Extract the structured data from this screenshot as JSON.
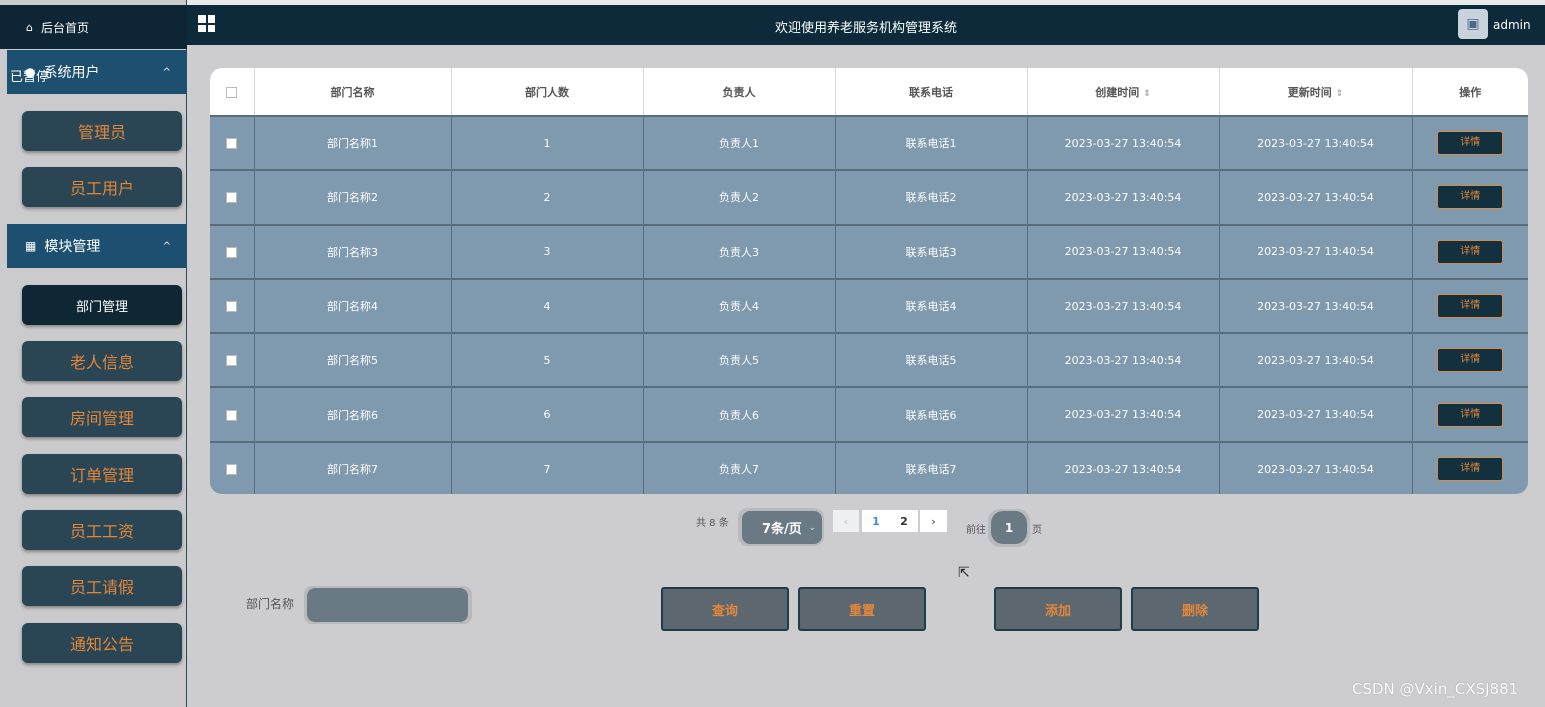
{
  "sidebar": {
    "home_label": "后台首页",
    "paused_label": "已暂停",
    "groups": [
      {
        "label": "系统用户",
        "items": [
          "管理员",
          "员工用户"
        ]
      },
      {
        "label": "模块管理",
        "items": [
          "部门管理",
          "老人信息",
          "房间管理",
          "订单管理",
          "员工工资",
          "员工请假",
          "通知公告"
        ]
      }
    ]
  },
  "topbar": {
    "title": "欢迎使用养老服务机构管理系统",
    "user": "admin"
  },
  "table": {
    "headers": [
      "部门名称",
      "部门人数",
      "负责人",
      "联系电话",
      "创建时间",
      "更新时间",
      "操作"
    ],
    "sort_glyph": "⇕",
    "detail_label": "详情",
    "rows": [
      [
        "部门名称1",
        "1",
        "负责人1",
        "联系电话1",
        "2023-03-27 13:40:54",
        "2023-03-27 13:40:54"
      ],
      [
        "部门名称2",
        "2",
        "负责人2",
        "联系电话2",
        "2023-03-27 13:40:54",
        "2023-03-27 13:40:54"
      ],
      [
        "部门名称3",
        "3",
        "负责人3",
        "联系电话3",
        "2023-03-27 13:40:54",
        "2023-03-27 13:40:54"
      ],
      [
        "部门名称4",
        "4",
        "负责人4",
        "联系电话4",
        "2023-03-27 13:40:54",
        "2023-03-27 13:40:54"
      ],
      [
        "部门名称5",
        "5",
        "负责人5",
        "联系电话5",
        "2023-03-27 13:40:54",
        "2023-03-27 13:40:54"
      ],
      [
        "部门名称6",
        "6",
        "负责人6",
        "联系电话6",
        "2023-03-27 13:40:54",
        "2023-03-27 13:40:54"
      ],
      [
        "部门名称7",
        "7",
        "负责人7",
        "联系电话7",
        "2023-03-27 13:40:54",
        "2023-03-27 13:40:54"
      ]
    ]
  },
  "pagination": {
    "total": "共 8 条",
    "page_size": "7条/页",
    "pages": [
      "1",
      "2"
    ],
    "current_page": "1",
    "goto_label": "前往",
    "goto_value": "1",
    "page_suffix": "页"
  },
  "search": {
    "label": "部门名称",
    "value": ""
  },
  "actions": {
    "query": "查询",
    "reset": "重置",
    "add": "添加",
    "delete": "删除"
  },
  "watermark": "CSDN @Vxin_CXSJ881",
  "colors": {
    "sidebar_dark": "#0d2535",
    "group_head": "#1d5070",
    "menu_button": "#2a4553",
    "accent_orange": "#e2873a",
    "table_row": "#7f9aaf"
  }
}
